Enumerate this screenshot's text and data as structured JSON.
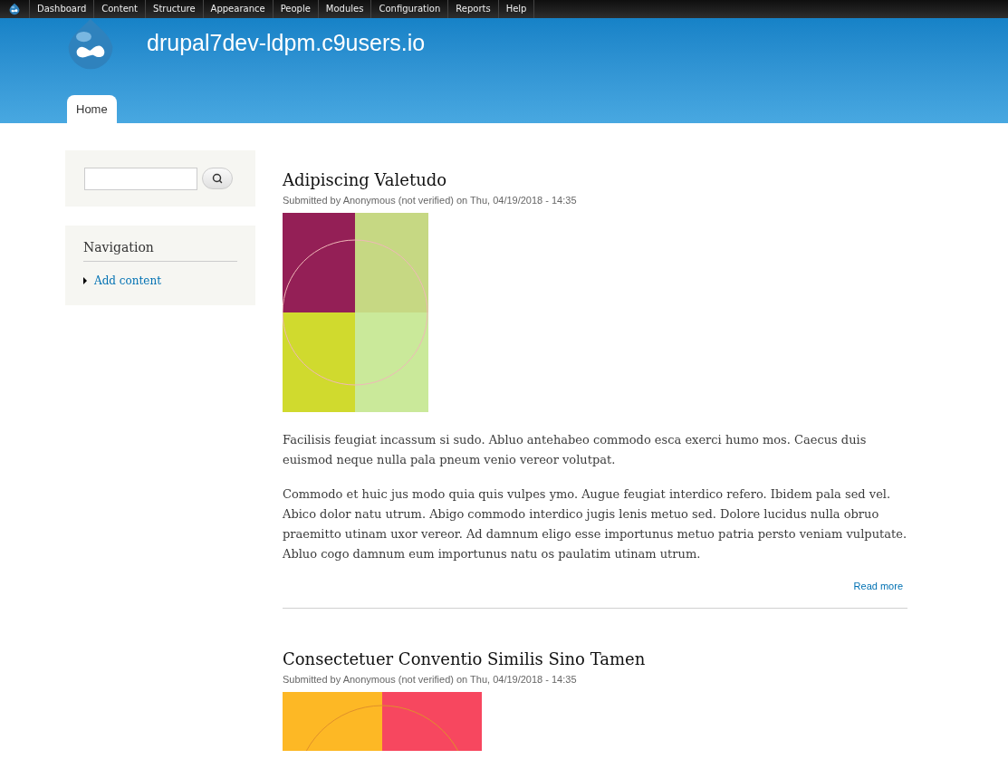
{
  "toolbar": {
    "items": [
      {
        "label": "Dashboard"
      },
      {
        "label": "Content"
      },
      {
        "label": "Structure"
      },
      {
        "label": "Appearance"
      },
      {
        "label": "People"
      },
      {
        "label": "Modules"
      },
      {
        "label": "Configuration"
      },
      {
        "label": "Reports"
      },
      {
        "label": "Help"
      }
    ]
  },
  "header": {
    "site_name": "drupal7dev-ldpm.c9users.io",
    "tabs": [
      {
        "label": "Home",
        "selected": true
      }
    ]
  },
  "sidebar": {
    "navigation": {
      "title": "Navigation",
      "items": [
        {
          "label": "Add content"
        }
      ]
    }
  },
  "articles": [
    {
      "title": "Adipiscing Valetudo",
      "meta": "Submitted by Anonymous (not verified) on Thu, 04/19/2018 - 14:35",
      "paragraphs": [
        "Facilisis feugiat incassum si sudo. Abluo antehabeo commodo esca exerci humo mos. Caecus duis euismod neque nulla pala pneum venio vereor volutpat.",
        "Commodo et huic jus modo quia quis vulpes ymo. Augue feugiat interdico refero. Ibidem pala sed vel. Abico dolor natu utrum. Abigo commodo interdico jugis lenis metuo sed. Dolore lucidus nulla obruo praemitto utinam uxor vereor. Ad damnum eligo esse importunus metuo patria persto veniam vulputate. Abluo cogo damnum eum importunus natu os paulatim utinam utrum."
      ],
      "read_more": "Read more"
    },
    {
      "title": "Consectetuer Conventio Similis Sino Tamen",
      "meta": "Submitted by Anonymous (not verified) on Thu, 04/19/2018 - 14:35"
    }
  ]
}
